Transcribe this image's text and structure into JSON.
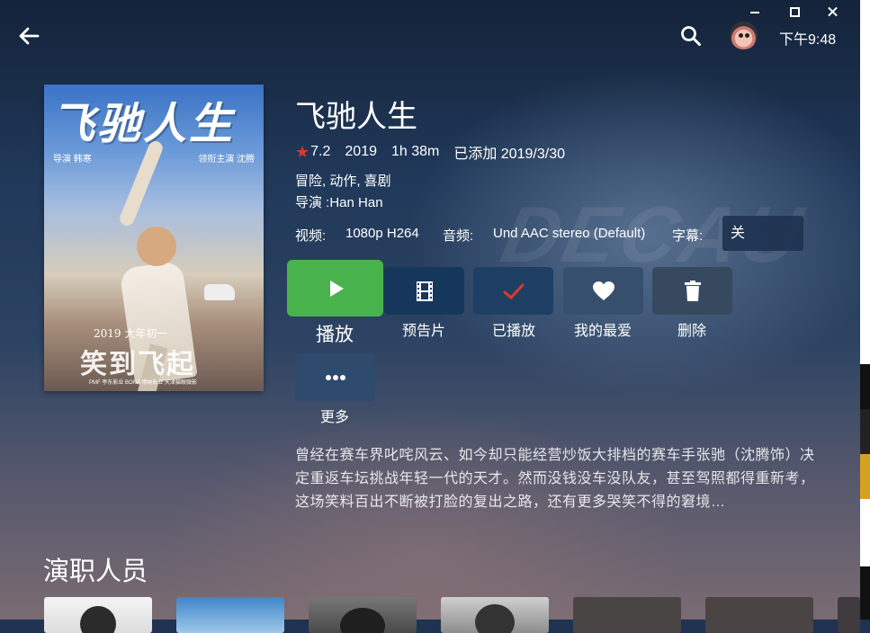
{
  "window": {
    "clock": "下午9:48"
  },
  "movie": {
    "title": "飞驰人生",
    "rating": "7.2",
    "year": "2019",
    "runtime": "1h 38m",
    "added": "已添加 2019/3/30",
    "genres": "冒险, 动作, 喜剧",
    "director": "导演 :Han Han",
    "overview": "曾经在赛车界叱咤风云、如今却只能经营炒饭大排档的赛车手张驰（沈腾饰）决定重返车坛挑战年轻一代的天才。然而没钱没车没队友，甚至驾照都得重新考，这场笑料百出不断被打脸的复出之路，还有更多哭笑不得的窘境…"
  },
  "poster": {
    "title": "飞驰人生",
    "credit_left": "导演 韩寒",
    "credit_right": "领衔主演 沈腾",
    "tagline_small": "2019 大年初一",
    "tagline_big": "笑到飞起",
    "footer": "PMF 亭东影业  BONA 博纳影业  天津猫眼微影"
  },
  "streams": {
    "video_label": "视频:",
    "video_value": "1080p H264",
    "audio_label": "音频:",
    "audio_value": "Und AAC stereo (Default)",
    "subtitle_label": "字幕:",
    "subtitle_value": "关"
  },
  "actions": {
    "play": "播放",
    "trailer": "预告片",
    "played": "已播放",
    "favorite": "我的最爱",
    "delete": "删除",
    "more": "更多"
  },
  "cast": {
    "heading": "演职人员"
  },
  "colors": {
    "play": "#48b34d",
    "star": "#e0362a",
    "check": "#e0362a"
  },
  "icons": [
    "back-arrow-icon",
    "search-icon",
    "play-icon",
    "film-icon",
    "check-icon",
    "heart-icon",
    "trash-icon",
    "more-dots-icon"
  ]
}
